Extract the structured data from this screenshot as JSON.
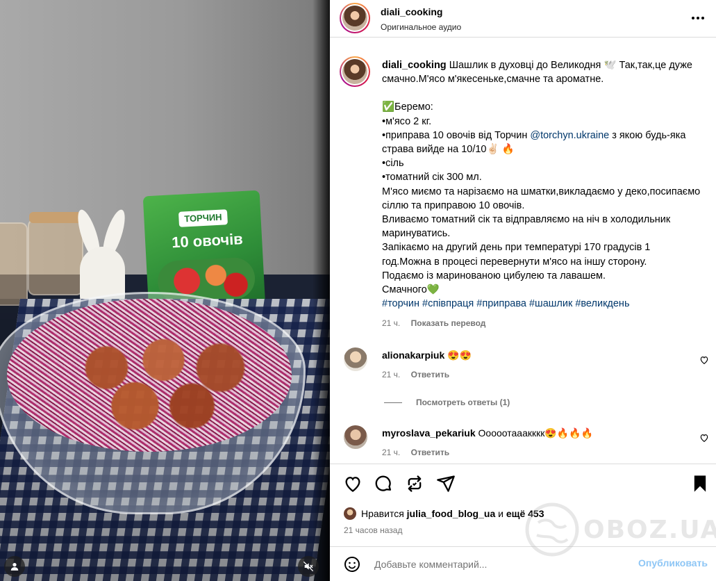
{
  "media": {
    "packet_brand": "ТОРЧИН",
    "packet_title": "10 овочів"
  },
  "post": {
    "username": "diali_cooking",
    "audio": "Оригинальное аудио"
  },
  "caption": {
    "username": "diali_cooking",
    "lines": [
      "Шашлик в духовці до Великодня 🕊️ Так,так,це дуже смачно.М'ясо м'якесеньке,смачне та ароматне."
    ],
    "take_header": "✅Беремо:",
    "item1": "•м'ясо 2 кг.",
    "item2_pre": "•приправа 10 овочів від Торчин ",
    "item2_link": "@torchyn.ukraine",
    "item2_post": " з якою будь-яка страва вийде на 10/10✌🏻 🔥",
    "item3": "•сіль",
    "item4": "•томатний сік 300 мл.",
    "p1": "М'ясо миємо та нарізаємо на шматки,викладаємо у деко,посипаємо сіллю та приправою 10 овочів.",
    "p2": "Вливаємо томатний сік та відправляємо на ніч в холодильник маринуватись.",
    "p3": "Запікаємо на другий день при температурі 170 градусів 1 год.Можна в процесі перевернути м'ясо на іншу сторону.",
    "p4": "Подаємо із маринованою цибулею та лавашем.",
    "p5": "Смачного💚",
    "hashtags": "#торчин #співпраця #приправа #шашлик #великдень",
    "time": "21 ч.",
    "translate": "Показать перевод"
  },
  "comments": [
    {
      "username": "alionakarpiuk",
      "text": "😍😍",
      "time": "21 ч.",
      "reply": "Ответить"
    },
    {
      "username": "myroslava_pekariuk",
      "text": "Ооооотааакккк😍🔥🔥🔥",
      "time": "21 ч.",
      "reply": "Ответить"
    }
  ],
  "view_replies": "Посмотреть ответы (1)",
  "likes": {
    "prefix": "Нравится ",
    "user": "julia_food_blog_ua",
    "middle": " и ",
    "rest": "ещё 453"
  },
  "posted": "21 часов назад",
  "add_comment": {
    "placeholder": "Добавьте комментарий...",
    "publish": "Опубликовать"
  },
  "watermark": "OBOZ.UA",
  "colors": {
    "link": "#00376b",
    "muted": "#737373",
    "publish_disabled": "#8ec6f5",
    "divider": "#dbdbdb"
  }
}
